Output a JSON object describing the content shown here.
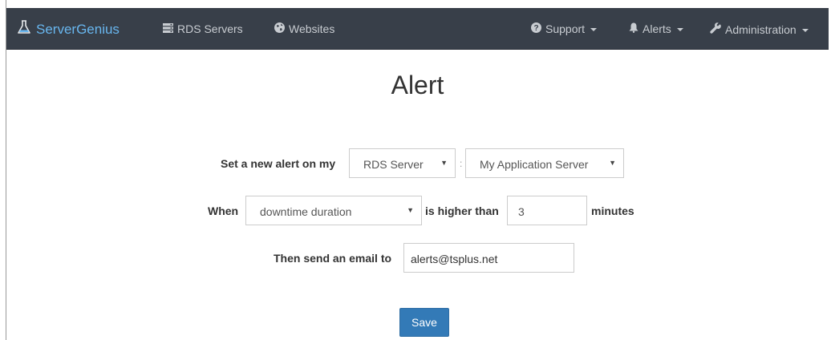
{
  "navbar": {
    "brand": "ServerGenius",
    "left_items": [
      {
        "label": "RDS Servers",
        "icon": "server-icon"
      },
      {
        "label": "Websites",
        "icon": "globe-icon"
      }
    ],
    "right_items": [
      {
        "label": "Support",
        "icon": "question-circle-icon"
      },
      {
        "label": "Alerts",
        "icon": "bell-icon"
      },
      {
        "label": "Administration",
        "icon": "wrench-icon"
      }
    ],
    "background": "#383f49",
    "brand_color": "#68b6ee"
  },
  "page": {
    "title": "Alert"
  },
  "form": {
    "row1_label": "Set a new alert on my",
    "target_type": "RDS Server",
    "separator": ":",
    "target_name": "My Application Server",
    "row2_label": "When",
    "metric": "downtime duration",
    "comparison_label": "is higher than",
    "threshold": "3",
    "unit_label": "minutes",
    "row3_label": "Then send an email to",
    "email": "alerts@tsplus.net",
    "save_label": "Save",
    "save_color": "#337ab7"
  }
}
